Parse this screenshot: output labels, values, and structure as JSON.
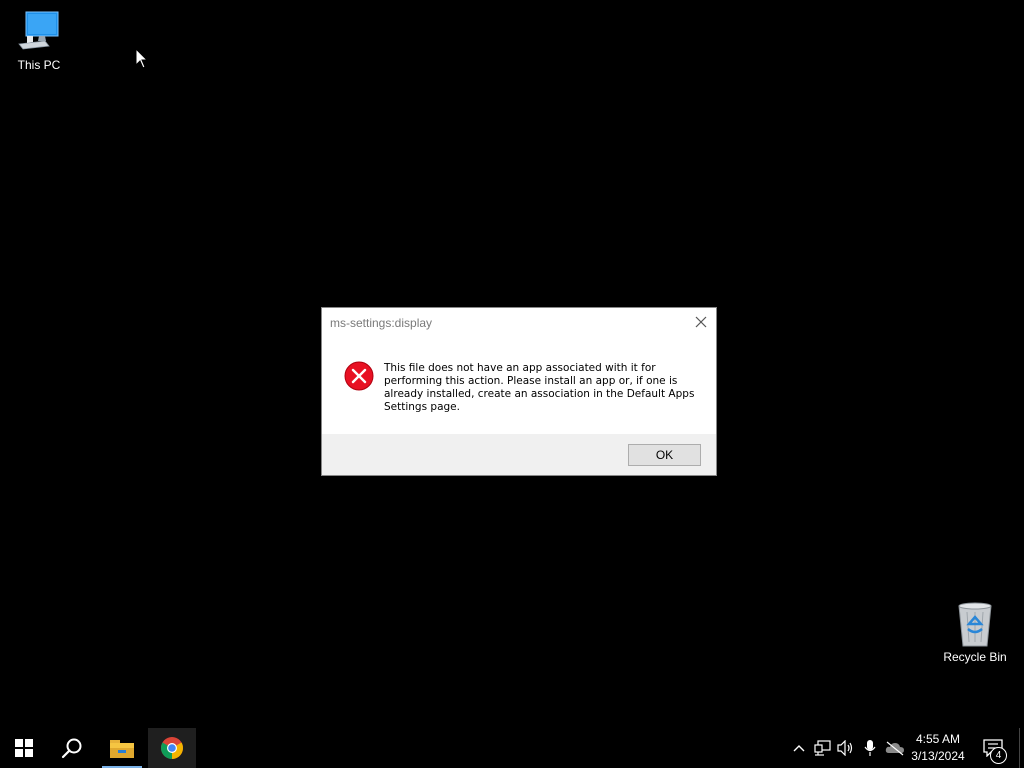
{
  "desktop": {
    "icons": [
      {
        "label": "This PC"
      },
      {
        "label": "Recycle Bin"
      }
    ]
  },
  "dialog": {
    "title": "ms-settings:display",
    "message": "This file does not have an app associated with it for performing this action. Please install an app or, if one is already installed, create an association in the Default Apps Settings page.",
    "ok_label": "OK"
  },
  "taskbar": {
    "start_icon": "windows-logo-icon",
    "search_icon": "search-icon",
    "pinned": [
      "file-explorer-icon",
      "chrome-icon"
    ],
    "tray_icons": [
      "chevron-up-icon",
      "network-icon",
      "volume-icon",
      "microphone-icon",
      "onedrive-icon"
    ],
    "clock": {
      "time": "4:55 AM",
      "date": "3/13/2024"
    },
    "notification_count": "4"
  },
  "colors": {
    "desktop_bg": "#000000",
    "taskbar_bg": "#000000",
    "error_red": "#e81123",
    "dialog_footer": "#f0f0f0"
  }
}
